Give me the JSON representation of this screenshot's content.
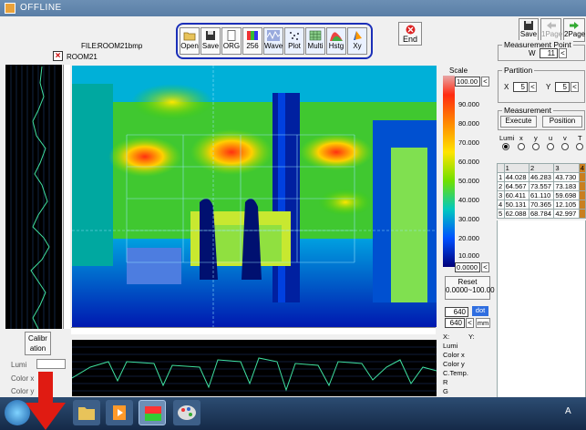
{
  "window": {
    "title": "OFFLINE"
  },
  "toolbar": {
    "buttons": [
      {
        "label": "Open",
        "icon": "folder-icon"
      },
      {
        "label": "Save",
        "icon": "floppy-icon"
      },
      {
        "label": "ORG",
        "icon": "document-icon"
      },
      {
        "label": "256",
        "icon": "palette-icon"
      },
      {
        "label": "Wave",
        "icon": "wave-icon"
      },
      {
        "label": "Plot",
        "icon": "scatter-icon"
      },
      {
        "label": "Multi",
        "icon": "grid-icon"
      },
      {
        "label": "Hstg",
        "icon": "histogram-icon"
      },
      {
        "label": "Xy",
        "icon": "chromaticity-icon"
      }
    ],
    "end_label": "End"
  },
  "top_right": {
    "save_label": "Save",
    "page1_label": "1Page",
    "page2_label": "2Page"
  },
  "file": {
    "label": "FILE:",
    "name": "ROOM21bmp",
    "room": "ROOM21"
  },
  "scale": {
    "title": "Scale",
    "max": "100.00",
    "min": "0.0000",
    "ticks": [
      "90.000",
      "80.000",
      "70.000",
      "60.000",
      "50.000",
      "40.000",
      "30.000",
      "20.000",
      "10.000"
    ],
    "colors": {
      "top": "#ff2b10",
      "bottom": "#00007a"
    }
  },
  "reset": {
    "label": "Reset",
    "range": "0.0000~100.00"
  },
  "resolution": {
    "w": "640",
    "w_unit": "dot",
    "h": "640",
    "h_unit": "mm"
  },
  "calibration": {
    "label": "Calibration",
    "lumi_label": "Lumi",
    "colorx_label": "Color x",
    "colory_label": "Color y"
  },
  "xy_panel": {
    "x_label": "X:",
    "y_label": "Y:",
    "rows": [
      "Lumi",
      "Color x",
      "Color y",
      "C.Temp.",
      "R",
      "G"
    ]
  },
  "measurement_point": {
    "title": "Measurement Point",
    "w_label": "W",
    "w_value": "11"
  },
  "partition": {
    "title": "Partition",
    "x_label": "X",
    "x_value": "5",
    "y_label": "Y",
    "y_value": "5"
  },
  "measurement": {
    "title": "Measurement",
    "execute_label": "Execute",
    "position_label": "Position",
    "radio_labels": [
      "Lumi",
      "x",
      "y",
      "u",
      "v",
      "T"
    ],
    "table": {
      "columns": [
        "",
        "1",
        "2",
        "3",
        "4"
      ],
      "rows": [
        [
          "1",
          "44.028",
          "46.283",
          "43.730",
          ""
        ],
        [
          "2",
          "64.567",
          "73.557",
          "73.183",
          ""
        ],
        [
          "3",
          "60.411",
          "61.110",
          "59.698",
          ""
        ],
        [
          "4",
          "50.131",
          "70.365",
          "12.105",
          ""
        ],
        [
          "5",
          "62.088",
          "68.784",
          "42.997",
          ""
        ]
      ]
    }
  },
  "taskbar": {
    "clock_partial": "A"
  }
}
